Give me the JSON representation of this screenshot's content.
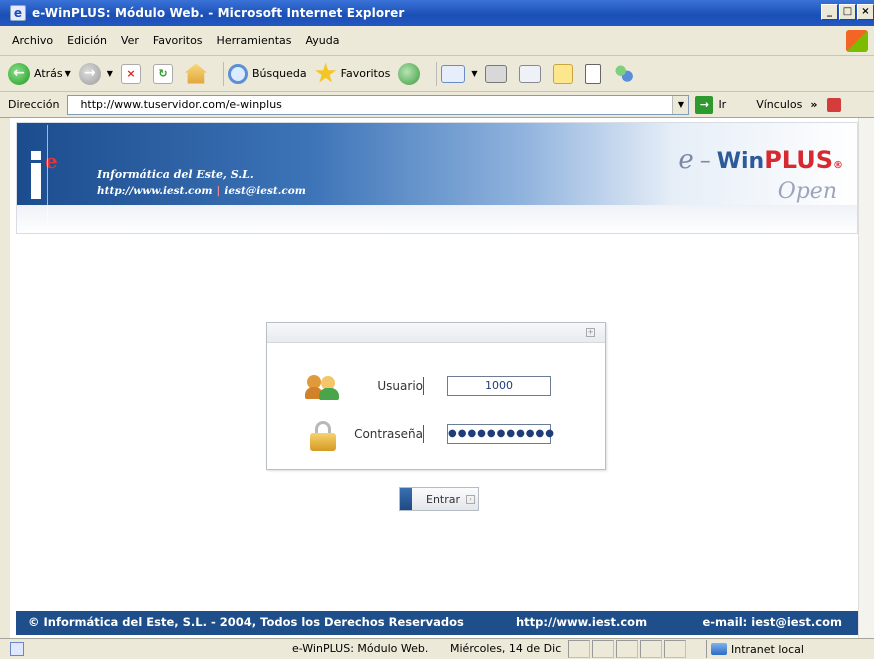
{
  "window": {
    "title": "e-WinPLUS: Módulo Web. - Microsoft Internet Explorer",
    "buttons": [
      "_",
      "□",
      "×"
    ]
  },
  "menu": [
    "Archivo",
    "Edición",
    "Ver",
    "Favoritos",
    "Herramientas",
    "Ayuda"
  ],
  "toolbar": {
    "back": "Atrás",
    "search": "Búsqueda",
    "favorites": "Favoritos"
  },
  "address": {
    "label": "Dirección",
    "url": "http://www.tuservidor.com/e-winplus",
    "go": "Ir",
    "links": "Vínculos",
    "more": "»"
  },
  "banner": {
    "company": "Informática del Este, S.L.",
    "web": "http://www.iest.com",
    "email": "iest@iest.com",
    "brand_e": "e",
    "brand_dash": "–",
    "brand_win": "Win",
    "brand_plus": "PLUS",
    "brand_reg": "®",
    "brand_open": "Open"
  },
  "login": {
    "user_label": "Usuario",
    "user_value": "1000",
    "pass_label": "Contraseña",
    "pass_value": "●●●●●●●●●●●",
    "submit": "Entrar"
  },
  "footer": {
    "copyright": "© Informática del Este, S.L. - 2004, Todos los Derechos Reservados",
    "url": "http://www.iest.com",
    "email": "e-mail: iest@iest.com"
  },
  "status": {
    "text": "e-WinPLUS: Módulo Web.",
    "date": "Miércoles, 14 de Dic",
    "zone": "Intranet local"
  },
  "icons": {
    "back": "back-arrow-icon",
    "forward": "forward-arrow-icon",
    "stop": "stop-icon",
    "refresh": "refresh-icon",
    "home": "home-icon",
    "search": "search-icon",
    "favorites": "star-icon",
    "history": "history-icon",
    "mail": "mail-icon",
    "print": "print-icon",
    "edit": "edit-icon",
    "users": "users-icon",
    "lock": "lock-icon"
  },
  "colors": {
    "titlebar": "#1a4fb5",
    "footer": "#1f4f8a",
    "accent_red": "#d62a30"
  }
}
